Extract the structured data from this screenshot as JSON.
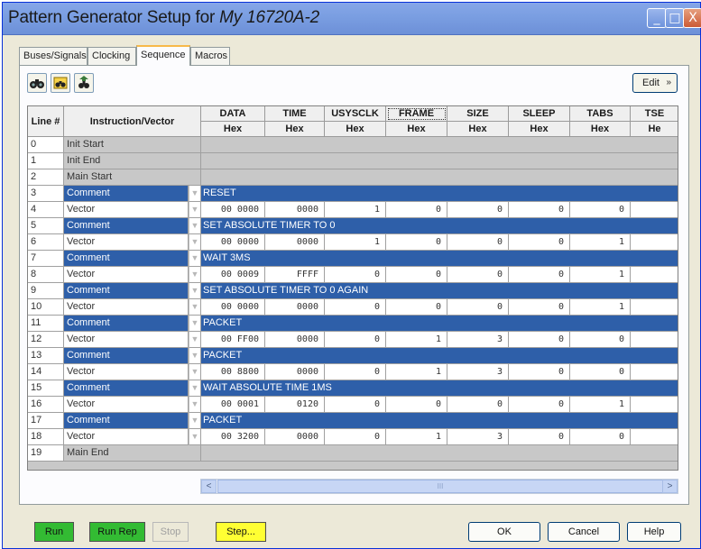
{
  "window": {
    "title_prefix": "Pattern Generator Setup for ",
    "title_device": "My 16720A-2",
    "controls": [
      "_",
      "□",
      "X"
    ]
  },
  "tabs": [
    {
      "label": "Buses/Signals",
      "active": false
    },
    {
      "label": "Clocking",
      "active": false
    },
    {
      "label": "Sequence",
      "active": true
    },
    {
      "label": "Macros",
      "active": false
    }
  ],
  "toolbar": {
    "icons": [
      "binoculars-icon",
      "find-prev-icon",
      "find-next-icon"
    ],
    "edit_label": "Edit",
    "edit_chevron": "»"
  },
  "grid": {
    "header_line": "Line #",
    "header_instr": "Instruction/Vector",
    "columns": [
      {
        "name": "DATA",
        "fmt": "Hex"
      },
      {
        "name": "TIME",
        "fmt": "Hex"
      },
      {
        "name": "USYSCLK",
        "fmt": "Hex"
      },
      {
        "name": "FRAME",
        "fmt": "Hex"
      },
      {
        "name": "SIZE",
        "fmt": "Hex"
      },
      {
        "name": "SLEEP",
        "fmt": "Hex"
      },
      {
        "name": "TABS",
        "fmt": "Hex"
      },
      {
        "name": "TSE",
        "fmt": "He"
      }
    ],
    "rows": [
      {
        "line": "0",
        "instr": "Init Start",
        "kind": "marker"
      },
      {
        "line": "1",
        "instr": "Init End",
        "kind": "marker"
      },
      {
        "line": "2",
        "instr": "Main Start",
        "kind": "marker"
      },
      {
        "line": "3",
        "instr": "Comment",
        "kind": "comment",
        "text": "RESET"
      },
      {
        "line": "4",
        "instr": "Vector",
        "kind": "vector",
        "values": [
          "00 0000",
          "0000",
          "1",
          "0",
          "0",
          "0",
          "0",
          ""
        ]
      },
      {
        "line": "5",
        "instr": "Comment",
        "kind": "comment",
        "text": "SET ABSOLUTE TIMER TO 0"
      },
      {
        "line": "6",
        "instr": "Vector",
        "kind": "vector",
        "values": [
          "00 0000",
          "0000",
          "1",
          "0",
          "0",
          "0",
          "1",
          ""
        ]
      },
      {
        "line": "7",
        "instr": "Comment",
        "kind": "comment",
        "text": "WAIT 3MS"
      },
      {
        "line": "8",
        "instr": "Vector",
        "kind": "vector",
        "values": [
          "00 0009",
          "FFFF",
          "0",
          "0",
          "0",
          "0",
          "1",
          ""
        ]
      },
      {
        "line": "9",
        "instr": "Comment",
        "kind": "comment",
        "text": "SET ABSOLUTE TIMER TO 0 AGAIN"
      },
      {
        "line": "10",
        "instr": "Vector",
        "kind": "vector",
        "values": [
          "00 0000",
          "0000",
          "0",
          "0",
          "0",
          "0",
          "1",
          ""
        ]
      },
      {
        "line": "11",
        "instr": "Comment",
        "kind": "comment",
        "text": "PACKET"
      },
      {
        "line": "12",
        "instr": "Vector",
        "kind": "vector",
        "values": [
          "00 FF00",
          "0000",
          "0",
          "1",
          "3",
          "0",
          "0",
          ""
        ]
      },
      {
        "line": "13",
        "instr": "Comment",
        "kind": "comment",
        "text": "PACKET"
      },
      {
        "line": "14",
        "instr": "Vector",
        "kind": "vector",
        "values": [
          "00 8800",
          "0000",
          "0",
          "1",
          "3",
          "0",
          "0",
          ""
        ]
      },
      {
        "line": "15",
        "instr": "Comment",
        "kind": "comment",
        "text": "WAIT ABSOLUTE TIME 1MS"
      },
      {
        "line": "16",
        "instr": "Vector",
        "kind": "vector",
        "values": [
          "00 0001",
          "0120",
          "0",
          "0",
          "0",
          "0",
          "1",
          ""
        ]
      },
      {
        "line": "17",
        "instr": "Comment",
        "kind": "comment",
        "text": "PACKET"
      },
      {
        "line": "18",
        "instr": "Vector",
        "kind": "vector",
        "values": [
          "00 3200",
          "0000",
          "0",
          "1",
          "3",
          "0",
          "0",
          ""
        ]
      },
      {
        "line": "19",
        "instr": "Main End",
        "kind": "marker"
      }
    ]
  },
  "scrollbar": {
    "left_arrow": "<",
    "right_arrow": ">",
    "grip": "III"
  },
  "buttons": {
    "run": "Run",
    "run_rep": "Run Rep",
    "stop": "Stop",
    "step": "Step...",
    "ok": "OK",
    "cancel": "Cancel",
    "help": "Help"
  },
  "colors": {
    "comment_blue": "#2e5fa9",
    "run_green": "#33bb33",
    "step_yellow": "#ffff33",
    "marker_gray": "#c8c8c8"
  }
}
